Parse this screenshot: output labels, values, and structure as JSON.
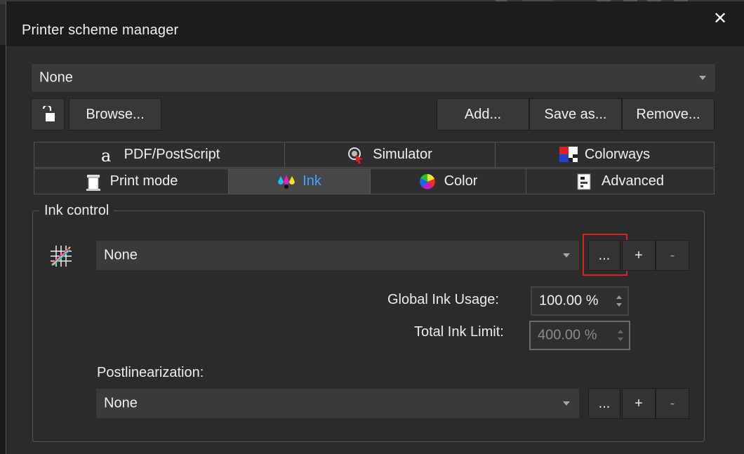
{
  "window": {
    "title": "Printer scheme manager",
    "close_label": "✕"
  },
  "scheme": {
    "selected": "None"
  },
  "toolbar": {
    "browse_label": "Browse...",
    "add_label": "Add...",
    "save_as_label": "Save as...",
    "remove_label": "Remove..."
  },
  "tabs_row1": [
    {
      "label": "PDF/PostScript",
      "icon": "pdf-postscript-icon"
    },
    {
      "label": "Simulator",
      "icon": "simulator-icon"
    },
    {
      "label": "Colorways",
      "icon": "colorways-icon"
    }
  ],
  "tabs_row2": [
    {
      "label": "Print mode",
      "icon": "print-mode-icon"
    },
    {
      "label": "Ink",
      "icon": "ink-icon",
      "active": true
    },
    {
      "label": "Color",
      "icon": "color-wheel-icon"
    },
    {
      "label": "Advanced",
      "icon": "advanced-icon"
    }
  ],
  "ink_control": {
    "group_label": "Ink control",
    "selected": "None",
    "more_label": "...",
    "plus_label": "+",
    "minus_label": "-",
    "global_ink_usage_label": "Global Ink Usage:",
    "global_ink_usage_value": "100.00 %",
    "total_ink_limit_label": "Total Ink Limit:",
    "total_ink_limit_value": "400.00 %",
    "postlinearization_label": "Postlinearization:",
    "postlinearization_selected": "None"
  },
  "colors": {
    "active_tab_text": "#3da6ff",
    "highlight": "#e02020"
  }
}
